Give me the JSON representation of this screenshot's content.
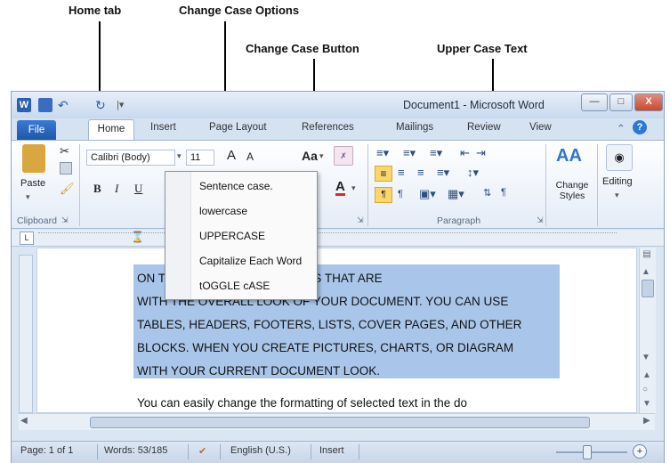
{
  "callouts": {
    "home_tab": "Home tab",
    "change_case_options": "Change Case Options",
    "change_case_button": "Change Case Button",
    "upper_case_text": "Upper Case Text"
  },
  "window": {
    "title": "Document1  -  Microsoft Word",
    "minimize": "—",
    "maximize": "□",
    "close": "X"
  },
  "tabs": {
    "file": "File",
    "home": "Home",
    "insert": "Insert",
    "page_layout": "Page Layout",
    "references": "References",
    "mailings": "Mailings",
    "review": "Review",
    "view": "View"
  },
  "ribbon": {
    "paste": "Paste",
    "clipboard": "Clipboard",
    "font_name": "Calibri (Body)",
    "font_size": "11",
    "grow": "A",
    "shrink": "A",
    "change_case": "Aa",
    "bold": "B",
    "italic": "I",
    "underline": "U",
    "font_color": "A",
    "paragraph": "Paragraph",
    "change_styles": "Change Styles",
    "styles_glyph": "AA",
    "editing": "Editing"
  },
  "menu": {
    "items": [
      "Sentence case.",
      "lowercase",
      "UPPERCASE",
      "Capitalize Each Word",
      "tOGGLE cASE"
    ]
  },
  "document": {
    "lines": [
      "ON T                          ALLERIES INCLUDE ITEMS THAT ARE",
      "WITH THE OVERALL LOOK OF YOUR DOCUMENT. YOU CAN USE",
      "TABLES, HEADERS, FOOTERS, LISTS, COVER PAGES, AND OTHER",
      "BLOCKS. WHEN YOU CREATE PICTURES, CHARTS, OR DIAGRAM",
      "WITH YOUR CURRENT DOCUMENT LOOK.",
      "You can easily change the formatting of selected text in the do"
    ]
  },
  "status": {
    "page": "Page: 1 of 1",
    "words": "Words: 53/185",
    "language": "English (U.S.)",
    "mode": "Insert"
  },
  "colors": {
    "selection": "#a9c6ea",
    "file_tab": "#2b6cc4",
    "ribbon_bg": "#dbe6f3"
  }
}
